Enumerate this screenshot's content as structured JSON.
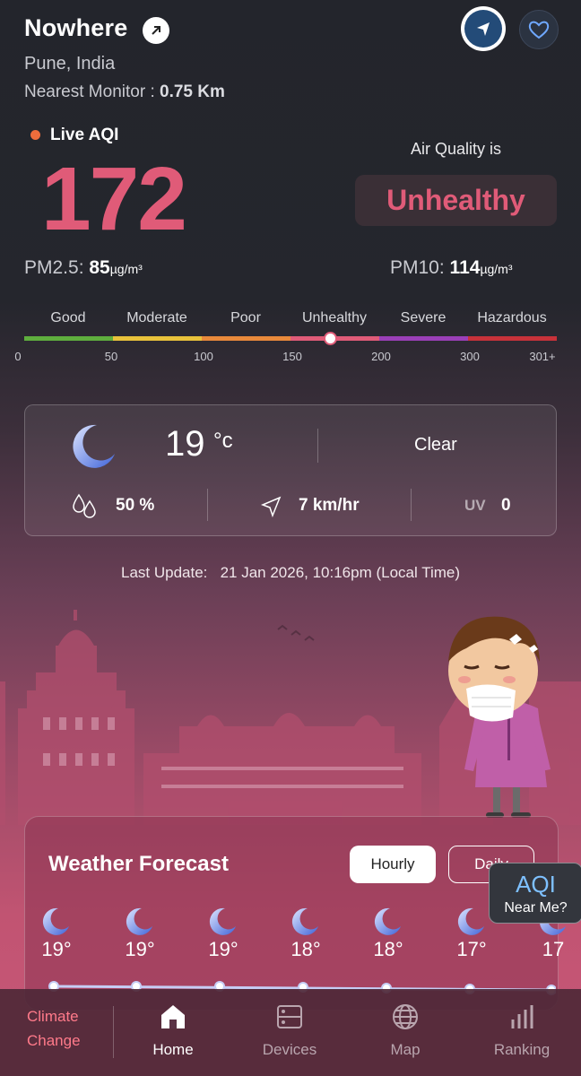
{
  "header": {
    "location": "Nowhere",
    "city": "Pune, India",
    "monitor_label": "Nearest Monitor :",
    "monitor_distance": "0.75 Km"
  },
  "aqi": {
    "live_label": "Live AQI",
    "value": "172",
    "status_prefix": "Air Quality is",
    "status": "Unhealthy",
    "status_color": "#e05b78",
    "pm25_label": "PM2.5:",
    "pm25_value": "85",
    "pm10_label": "PM10:",
    "pm10_value": "114",
    "unit": "µg/m³"
  },
  "scale": {
    "categories": [
      "Good",
      "Moderate",
      "Poor",
      "Unhealthy",
      "Severe",
      "Hazardous"
    ],
    "colors": [
      "#5fae3e",
      "#e9c23b",
      "#e9893b",
      "#e05b78",
      "#9b3fb8",
      "#c8323a"
    ],
    "ticks": [
      "0",
      "50",
      "100",
      "150",
      "200",
      "300",
      "301+"
    ],
    "marker_value": 172
  },
  "weather": {
    "temperature": "19",
    "temp_unit": "°c",
    "condition": "Clear",
    "humidity": "50 %",
    "wind": "7 km/hr",
    "uv_label": "UV",
    "uv_value": "0"
  },
  "update": {
    "label": "Last Update:",
    "time": "21 Jan 2026, 10:16pm (Local Time)"
  },
  "forecast": {
    "title": "Weather Forecast",
    "hourly_label": "Hourly",
    "daily_label": "Daily",
    "temps": [
      "19°",
      "19°",
      "19°",
      "18°",
      "18°",
      "17°",
      "17"
    ]
  },
  "near_me": {
    "brand": "AQI",
    "label": "Near Me?"
  },
  "bottom_nav": {
    "climate_line1": "Climate",
    "climate_line2": "Change",
    "items": [
      {
        "label": "Home",
        "icon": "home-icon"
      },
      {
        "label": "Devices",
        "icon": "devices-icon"
      },
      {
        "label": "Map",
        "icon": "globe-icon"
      },
      {
        "label": "Ranking",
        "icon": "ranking-icon"
      }
    ]
  }
}
